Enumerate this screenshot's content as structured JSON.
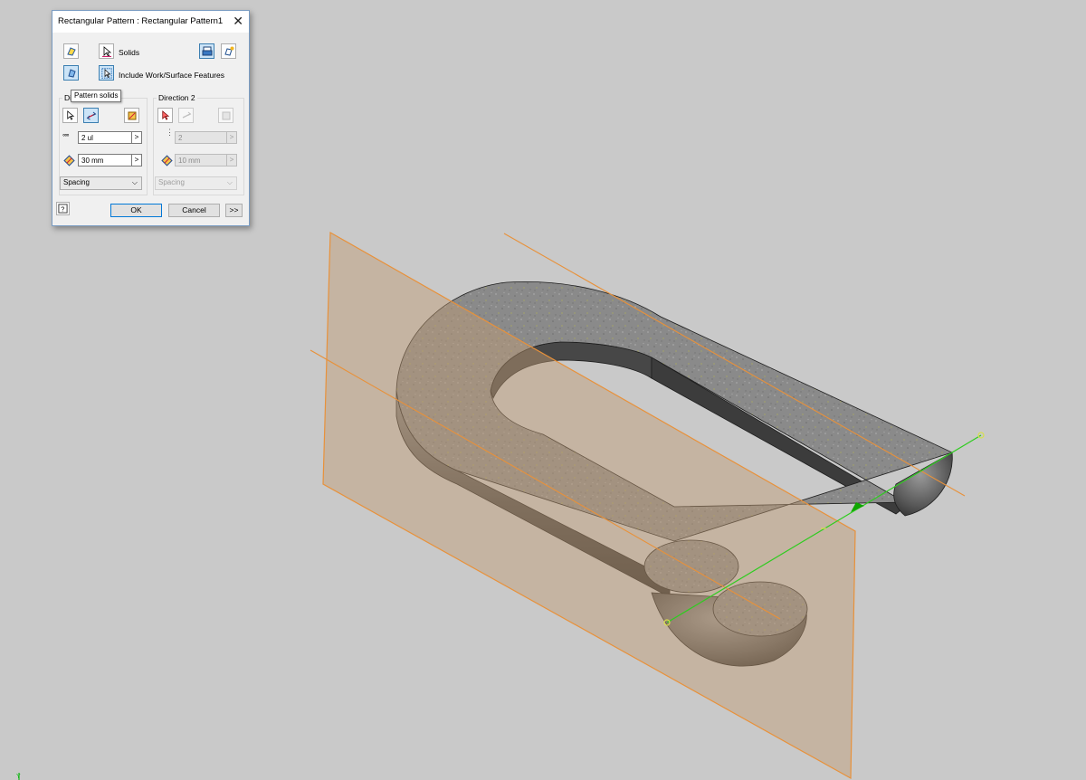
{
  "dialog": {
    "title": "Rectangular Pattern : Rectangular Pattern1",
    "solids_label": "Solids",
    "include_label": "Include Work/Surface Features",
    "direction1_title": "Di",
    "direction2_title": "Direction 2",
    "tooltip": "Pattern solids",
    "dir1": {
      "count": "2 ul",
      "spacing": "30 mm",
      "method": "Spacing"
    },
    "dir2": {
      "count": "2",
      "spacing": "10 mm",
      "method": "Spacing"
    },
    "ok": "OK",
    "cancel": "Cancel",
    "more": ">>",
    "count_glyph": "°°°"
  },
  "axis_label": "Y",
  "colors": {
    "background": "#c9c9c9",
    "work_plane": "#b8a796",
    "work_plane_edge": "#e8913a",
    "axis_green": "#2ecc1f",
    "accent_blue": "#0078d7"
  }
}
